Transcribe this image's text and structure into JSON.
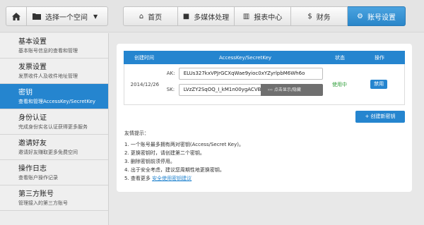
{
  "topbar": {
    "space_select_label": "选择一个空间",
    "nav": [
      {
        "label": "首页",
        "icon": "home-icon",
        "glyph": "⌂"
      },
      {
        "label": "多媒体处理",
        "icon": "video-camera-icon",
        "glyph": "■"
      },
      {
        "label": "报表中心",
        "icon": "bar-chart-icon",
        "glyph": "▥"
      },
      {
        "label": "财务",
        "icon": "dollar-icon",
        "glyph": "$"
      },
      {
        "label": "账号设置",
        "icon": "gear-icon",
        "glyph": "⚙"
      }
    ]
  },
  "sidebar": {
    "items": [
      {
        "title": "基本设置",
        "desc": "基本账号信息的查看和管理"
      },
      {
        "title": "发票设置",
        "desc": "发票收件人及收件地址管理"
      },
      {
        "title": "密钥",
        "desc": "查看和管理AccessKey/SecretKey"
      },
      {
        "title": "身份认证",
        "desc": "完成身份实名认证获得更多服务"
      },
      {
        "title": "邀请好友",
        "desc": "邀请好友赚取更多免费空间"
      },
      {
        "title": "操作日志",
        "desc": "查看账户操作记录"
      },
      {
        "title": "第三方账号",
        "desc": "管理接入的第三方账号"
      }
    ]
  },
  "table": {
    "headers": {
      "created": "创建时间",
      "keys": "AccessKey/SecretKey",
      "status": "状态",
      "action": "操作"
    },
    "row": {
      "created": "2014/12/26",
      "ak_label": "AK:",
      "ak_value": "ELUs327kxVPJrGCXqWae9yioc0xYZyrlpbM6Wh6o",
      "sk_label": "SK:",
      "sk_value": "LVzZY2SqOQ_I_kM1n00ygACVBA",
      "reveal_label": "点击显示/隐藏",
      "status": "使用中",
      "action": "禁用"
    }
  },
  "create_button": "+ 创建新密钥",
  "tips": {
    "title": "友情提示：",
    "items": [
      "1. 一个账号最多拥有两对密钥(Access/Secret Key)。",
      "2. 更换密钥时，请创建第二个密钥。",
      "3. 删除密钥前须停用。",
      "4. 出于安全考虑，建议您周期性地更换密钥。"
    ],
    "last_prefix": "5. 查看更多",
    "last_link": "安全使用密钥建议"
  }
}
